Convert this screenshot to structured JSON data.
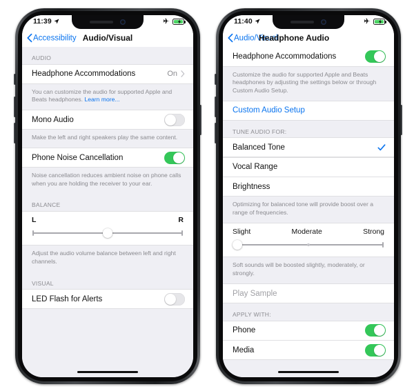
{
  "phones": [
    {
      "id": "audio-visual",
      "status_bar": {
        "time": "11:39",
        "location_icon": "location-arrow-icon",
        "airplane_icon": "airplane-mode-icon",
        "battery_icon": "battery-charging-icon"
      },
      "nav": {
        "back_label": "Accessibility",
        "title": "Audio/Visual",
        "back_icon": "chevron-left-icon"
      },
      "sections": [
        {
          "header": "AUDIO",
          "rows": [
            {
              "type": "disclosure",
              "label": "Headphone Accommodations",
              "value": "On",
              "icon": "chevron-right-icon"
            },
            {
              "type": "footnote",
              "text": "You can customize the audio for supported Apple and Beats headphones. ",
              "link": "Learn more..."
            },
            {
              "type": "toggle",
              "label": "Mono Audio",
              "state": "off"
            },
            {
              "type": "footnote",
              "text": "Make the left and right speakers play the same content."
            },
            {
              "type": "toggle",
              "label": "Phone Noise Cancellation",
              "state": "on"
            },
            {
              "type": "footnote",
              "text": "Noise cancellation reduces ambient noise on phone calls when you are holding the receiver to your ear."
            }
          ]
        },
        {
          "header": "BALANCE",
          "rows": [
            {
              "type": "slider",
              "left_label": "L",
              "right_label": "R",
              "position": "center"
            },
            {
              "type": "footnote",
              "text": "Adjust the audio volume balance between left and right channels."
            }
          ]
        },
        {
          "header": "VISUAL",
          "rows": [
            {
              "type": "toggle",
              "label": "LED Flash for Alerts",
              "state": "off"
            }
          ]
        }
      ]
    },
    {
      "id": "headphone-audio",
      "status_bar": {
        "time": "11:40",
        "location_icon": "location-arrow-icon",
        "airplane_icon": "airplane-mode-icon",
        "battery_icon": "battery-charging-icon"
      },
      "nav": {
        "back_label": "Audio/Visual",
        "title": "Headphone Audio",
        "back_icon": "chevron-left-icon"
      },
      "sections": [
        {
          "header": "",
          "rows": [
            {
              "type": "toggle",
              "label": "Headphone Accommodations",
              "state": "on"
            },
            {
              "type": "footnote",
              "text": "Customize the audio for supported Apple and Beats headphones by adjusting the settings below or through Custom Audio Setup."
            },
            {
              "type": "link",
              "label": "Custom Audio Setup"
            }
          ]
        },
        {
          "header": "TUNE AUDIO FOR:",
          "rows": [
            {
              "type": "check",
              "label": "Balanced Tone",
              "checked": true,
              "icon": "checkmark-icon"
            },
            {
              "type": "check",
              "label": "Vocal Range",
              "checked": false
            },
            {
              "type": "check",
              "label": "Brightness",
              "checked": false
            },
            {
              "type": "footnote",
              "text": "Optimizing for balanced tone will provide boost over a range of frequencies."
            },
            {
              "type": "slider3",
              "left_label": "Slight",
              "mid_label": "Moderate",
              "right_label": "Strong",
              "position": "start"
            },
            {
              "type": "footnote",
              "text": "Soft sounds will be boosted slightly, moderately, or strongly."
            },
            {
              "type": "disabled",
              "label": "Play Sample"
            }
          ]
        },
        {
          "header": "APPLY WITH:",
          "rows": [
            {
              "type": "toggle",
              "label": "Phone",
              "state": "on"
            },
            {
              "type": "toggle",
              "label": "Media",
              "state": "on"
            }
          ]
        }
      ]
    }
  ],
  "colors": {
    "accent": "#0a74ef",
    "toggle_on": "#34c759",
    "background": "#efeff4",
    "cell": "#ffffff"
  }
}
